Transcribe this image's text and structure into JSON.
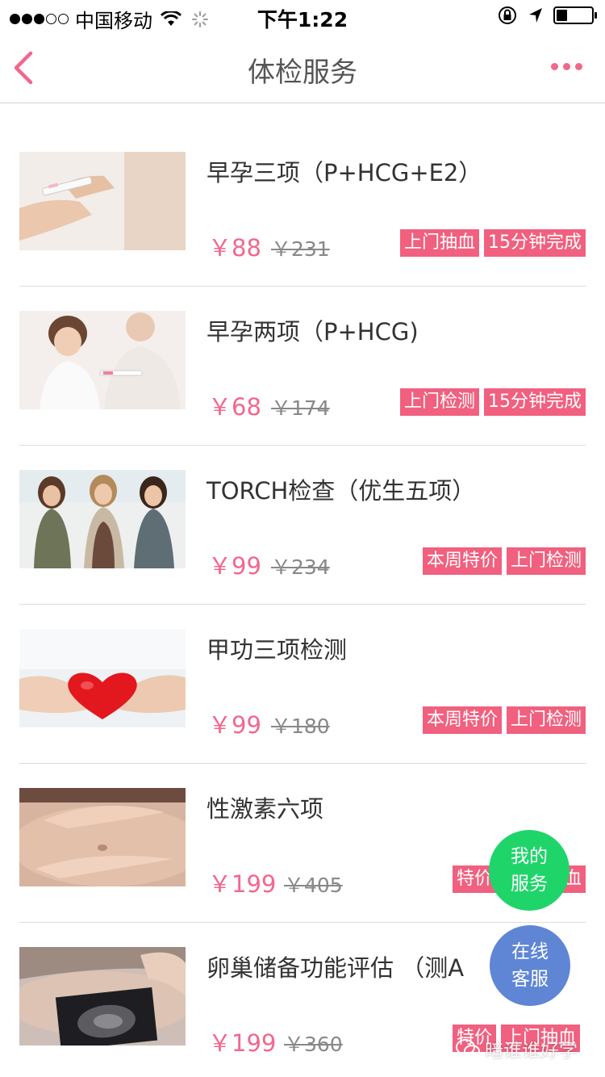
{
  "status": {
    "carrier": "中国移动",
    "time": "下午1:22",
    "battery_level": 0.3
  },
  "nav": {
    "title": "体检服务"
  },
  "items": [
    {
      "title": "早孕三项（P+HCG+E2）",
      "price": "￥88",
      "orig": "￥231",
      "tags": [
        "上门抽血",
        "15分钟完成"
      ],
      "image": "pregnancy-test-photo"
    },
    {
      "title": "早孕两项（P+HCG)",
      "price": "￥68",
      "orig": "￥174",
      "tags": [
        "上门检测",
        "15分钟完成"
      ],
      "image": "couple-pregnancy-test-photo"
    },
    {
      "title": "TORCH检查（优生五项）",
      "price": "￥99",
      "orig": "￥234",
      "tags": [
        "本周特价",
        "上门检测"
      ],
      "image": "three-pregnant-women-photo"
    },
    {
      "title": "甲功三项检测",
      "price": "￥99",
      "orig": "￥180",
      "tags": [
        "本周特价",
        "上门检测"
      ],
      "image": "hands-heart-photo"
    },
    {
      "title": "性激素六项",
      "price": "￥199",
      "orig": "￥405",
      "tags": [
        "特价",
        "血"
      ],
      "image": "hands-belly-photo"
    },
    {
      "title": "卵巢储备功能评估 （测A",
      "price": "￥199",
      "orig": "￥360",
      "tags": [
        "特价",
        "上门抽血"
      ],
      "image": "ultrasound-photo"
    }
  ],
  "fab": {
    "my_service": [
      "我的",
      "服务"
    ],
    "online_service": [
      "在线",
      "客服"
    ]
  },
  "watermark": {
    "text": "暗谁谁好学"
  },
  "colors": {
    "accent": "#f2678e",
    "tag_bg": "#f1607f",
    "fab_green": "#1fd56a",
    "fab_blue": "#5f86d4"
  }
}
